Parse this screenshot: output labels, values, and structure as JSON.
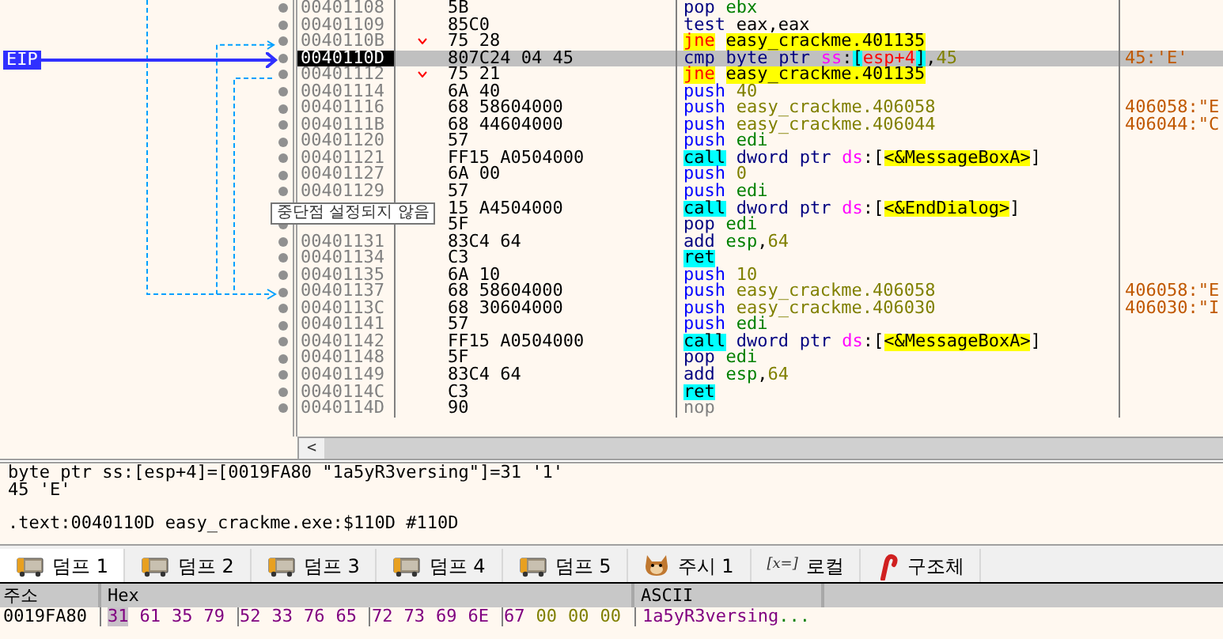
{
  "eip_label": "EIP",
  "rows": [
    {
      "address": "00401108",
      "bytes": "5B",
      "selected": false,
      "jump": false,
      "asm": [
        [
          {
            "kind": "op",
            "text": "pop"
          }
        ],
        [
          {
            "kind": "reg",
            "text": "ebx"
          }
        ]
      ]
    },
    {
      "address": "00401109",
      "bytes": "85C0",
      "selected": false,
      "jump": false,
      "asm": [
        [
          {
            "kind": "op",
            "text": "test"
          }
        ],
        [
          {
            "kind": "plain",
            "text": "eax,eax"
          }
        ]
      ]
    },
    {
      "address": "0040110B",
      "bytes": "75 28",
      "selected": false,
      "jump": true,
      "asm": [
        [
          {
            "kind": "jcc",
            "text": "jne"
          }
        ],
        [
          {
            "kind": "target",
            "text": "easy_crackme.401135"
          }
        ]
      ]
    },
    {
      "address": "0040110D",
      "bytes": "807C24 04 45",
      "selected": true,
      "jump": false,
      "asm": [
        [
          {
            "kind": "op",
            "text": "cmp"
          }
        ],
        [
          {
            "kind": "ptr",
            "text": "byte"
          }
        ],
        [
          {
            "kind": "ptr",
            "text": "ptr"
          }
        ],
        [
          {
            "kind": "seg",
            "text": "ss"
          },
          {
            "kind": "plain",
            "text": ":"
          },
          {
            "kind": "bracket",
            "text": "["
          },
          {
            "kind": "memreg",
            "text": "esp+4"
          },
          {
            "kind": "bracket",
            "text": "]"
          },
          {
            "kind": "plain",
            "text": ","
          },
          {
            "kind": "imm",
            "text": "45"
          }
        ]
      ],
      "comment": "45:'E'"
    },
    {
      "address": "00401112",
      "bytes": "75 21",
      "selected": false,
      "jump": true,
      "asm": [
        [
          {
            "kind": "jcc",
            "text": "jne"
          }
        ],
        [
          {
            "kind": "target",
            "text": "easy_crackme.401135"
          }
        ]
      ]
    },
    {
      "address": "00401114",
      "bytes": "6A 40",
      "selected": false,
      "jump": false,
      "asm": [
        [
          {
            "kind": "push",
            "text": "push"
          }
        ],
        [
          {
            "kind": "imm",
            "text": "40"
          }
        ]
      ]
    },
    {
      "address": "00401116",
      "bytes": "68 58604000",
      "selected": false,
      "jump": false,
      "asm": [
        [
          {
            "kind": "push",
            "text": "push"
          }
        ],
        [
          {
            "kind": "imm",
            "text": "easy_crackme.406058"
          }
        ]
      ],
      "comment": "406058:\"E"
    },
    {
      "address": "0040111B",
      "bytes": "68 44604000",
      "selected": false,
      "jump": false,
      "asm": [
        [
          {
            "kind": "push",
            "text": "push"
          }
        ],
        [
          {
            "kind": "imm",
            "text": "easy_crackme.406044"
          }
        ]
      ],
      "comment": "406044:\"C"
    },
    {
      "address": "00401120",
      "bytes": "57",
      "selected": false,
      "jump": false,
      "asm": [
        [
          {
            "kind": "push",
            "text": "push"
          }
        ],
        [
          {
            "kind": "reg",
            "text": "edi"
          }
        ]
      ]
    },
    {
      "address": "00401121",
      "bytes": "FF15 A0504000",
      "selected": false,
      "jump": false,
      "asm": [
        [
          {
            "kind": "call",
            "text": "call"
          }
        ],
        [
          {
            "kind": "ptr",
            "text": "dword"
          }
        ],
        [
          {
            "kind": "ptr",
            "text": "ptr"
          }
        ],
        [
          {
            "kind": "seg",
            "text": "ds"
          },
          {
            "kind": "plain",
            "text": ":["
          },
          {
            "kind": "api",
            "text": "<&MessageBoxA>"
          },
          {
            "kind": "plain",
            "text": "]"
          }
        ]
      ]
    },
    {
      "address": "00401127",
      "bytes": "6A 00",
      "selected": false,
      "jump": false,
      "asm": [
        [
          {
            "kind": "push",
            "text": "push"
          }
        ],
        [
          {
            "kind": "imm",
            "text": "0"
          }
        ]
      ]
    },
    {
      "address": "00401129",
      "bytes": "57",
      "selected": false,
      "jump": false,
      "asm": [
        [
          {
            "kind": "push",
            "text": "push"
          }
        ],
        [
          {
            "kind": "reg",
            "text": "edi"
          }
        ]
      ]
    },
    {
      "bytes": "15 A4504000",
      "selected": false,
      "jump": false,
      "asm": [
        [
          {
            "kind": "call",
            "text": "call"
          }
        ],
        [
          {
            "kind": "ptr",
            "text": "dword"
          }
        ],
        [
          {
            "kind": "ptr",
            "text": "ptr"
          }
        ],
        [
          {
            "kind": "seg",
            "text": "ds"
          },
          {
            "kind": "plain",
            "text": ":["
          },
          {
            "kind": "api",
            "text": "<&EndDialog>"
          },
          {
            "kind": "plain",
            "text": "]"
          }
        ]
      ]
    },
    {
      "bytes": "5F",
      "selected": false,
      "jump": false,
      "asm": [
        [
          {
            "kind": "op",
            "text": "pop"
          }
        ],
        [
          {
            "kind": "reg",
            "text": "edi"
          }
        ]
      ]
    },
    {
      "address": "00401131",
      "bytes": "83C4 64",
      "selected": false,
      "jump": false,
      "asm": [
        [
          {
            "kind": "op",
            "text": "add"
          }
        ],
        [
          {
            "kind": "reg",
            "text": "esp"
          },
          {
            "kind": "plain",
            "text": ","
          },
          {
            "kind": "imm",
            "text": "64"
          }
        ]
      ]
    },
    {
      "address": "00401134",
      "bytes": "C3",
      "selected": false,
      "jump": false,
      "asm": [
        [
          {
            "kind": "call",
            "text": "ret"
          }
        ]
      ]
    },
    {
      "address": "00401135",
      "bytes": "6A 10",
      "selected": false,
      "jump": false,
      "asm": [
        [
          {
            "kind": "push",
            "text": "push"
          }
        ],
        [
          {
            "kind": "imm",
            "text": "10"
          }
        ]
      ]
    },
    {
      "address": "00401137",
      "bytes": "68 58604000",
      "selected": false,
      "jump": false,
      "asm": [
        [
          {
            "kind": "push",
            "text": "push"
          }
        ],
        [
          {
            "kind": "imm",
            "text": "easy_crackme.406058"
          }
        ]
      ],
      "comment": "406058:\"E"
    },
    {
      "address": "0040113C",
      "bytes": "68 30604000",
      "selected": false,
      "jump": false,
      "asm": [
        [
          {
            "kind": "push",
            "text": "push"
          }
        ],
        [
          {
            "kind": "imm",
            "text": "easy_crackme.406030"
          }
        ]
      ],
      "comment": "406030:\"I"
    },
    {
      "address": "00401141",
      "bytes": "57",
      "selected": false,
      "jump": false,
      "asm": [
        [
          {
            "kind": "push",
            "text": "push"
          }
        ],
        [
          {
            "kind": "reg",
            "text": "edi"
          }
        ]
      ]
    },
    {
      "address": "00401142",
      "bytes": "FF15 A0504000",
      "selected": false,
      "jump": false,
      "asm": [
        [
          {
            "kind": "call",
            "text": "call"
          }
        ],
        [
          {
            "kind": "ptr",
            "text": "dword"
          }
        ],
        [
          {
            "kind": "ptr",
            "text": "ptr"
          }
        ],
        [
          {
            "kind": "seg",
            "text": "ds"
          },
          {
            "kind": "plain",
            "text": ":["
          },
          {
            "kind": "api",
            "text": "<&MessageBoxA>"
          },
          {
            "kind": "plain",
            "text": "]"
          }
        ]
      ]
    },
    {
      "address": "00401148",
      "bytes": "5F",
      "selected": false,
      "jump": false,
      "asm": [
        [
          {
            "kind": "op",
            "text": "pop"
          }
        ],
        [
          {
            "kind": "reg",
            "text": "edi"
          }
        ]
      ]
    },
    {
      "address": "00401149",
      "bytes": "83C4 64",
      "selected": false,
      "jump": false,
      "asm": [
        [
          {
            "kind": "op",
            "text": "add"
          }
        ],
        [
          {
            "kind": "reg",
            "text": "esp"
          },
          {
            "kind": "plain",
            "text": ","
          },
          {
            "kind": "imm",
            "text": "64"
          }
        ]
      ]
    },
    {
      "address": "0040114C",
      "bytes": "C3",
      "selected": false,
      "jump": false,
      "asm": [
        [
          {
            "kind": "call",
            "text": "ret"
          }
        ]
      ]
    },
    {
      "address": "0040114D",
      "bytes": "90",
      "selected": false,
      "jump": false,
      "asm": [
        [
          {
            "kind": "nop",
            "text": "nop"
          }
        ]
      ]
    }
  ],
  "tooltip": "중단점 설정되지 않음",
  "scroll_left": "<",
  "info_lines": [
    "byte ptr ss:[esp+4]=[0019FA80 \"1a5yR3versing\"]=31 '1'",
    "45 'E'",
    ".text:0040110D easy_crackme.exe:$110D #110D"
  ],
  "tabs": [
    {
      "label": "덤프 1",
      "kind": "dump",
      "selected": true
    },
    {
      "label": "덤프 2",
      "kind": "dump",
      "selected": false
    },
    {
      "label": "덤프 3",
      "kind": "dump",
      "selected": false
    },
    {
      "label": "덤프 4",
      "kind": "dump",
      "selected": false
    },
    {
      "label": "덤프 5",
      "kind": "dump",
      "selected": false
    },
    {
      "label": "주시 1",
      "kind": "watch",
      "selected": false
    },
    {
      "label": "로컬",
      "kind": "locals",
      "icon_text": "[x=]",
      "selected": false
    },
    {
      "label": "구조체",
      "kind": "struct",
      "selected": false
    }
  ],
  "dump": {
    "columns": [
      "주소",
      "Hex",
      "ASCII"
    ],
    "rows": [
      {
        "address": "0019FA80",
        "groups": [
          [
            "31",
            "61",
            "35",
            "79"
          ],
          [
            "52",
            "33",
            "76",
            "65"
          ],
          [
            "72",
            "73",
            "69",
            "6E"
          ],
          [
            "67",
            "00",
            "00",
            "00"
          ]
        ],
        "ascii": "1a5yR3versing",
        "ascii_dots": "..."
      }
    ]
  }
}
